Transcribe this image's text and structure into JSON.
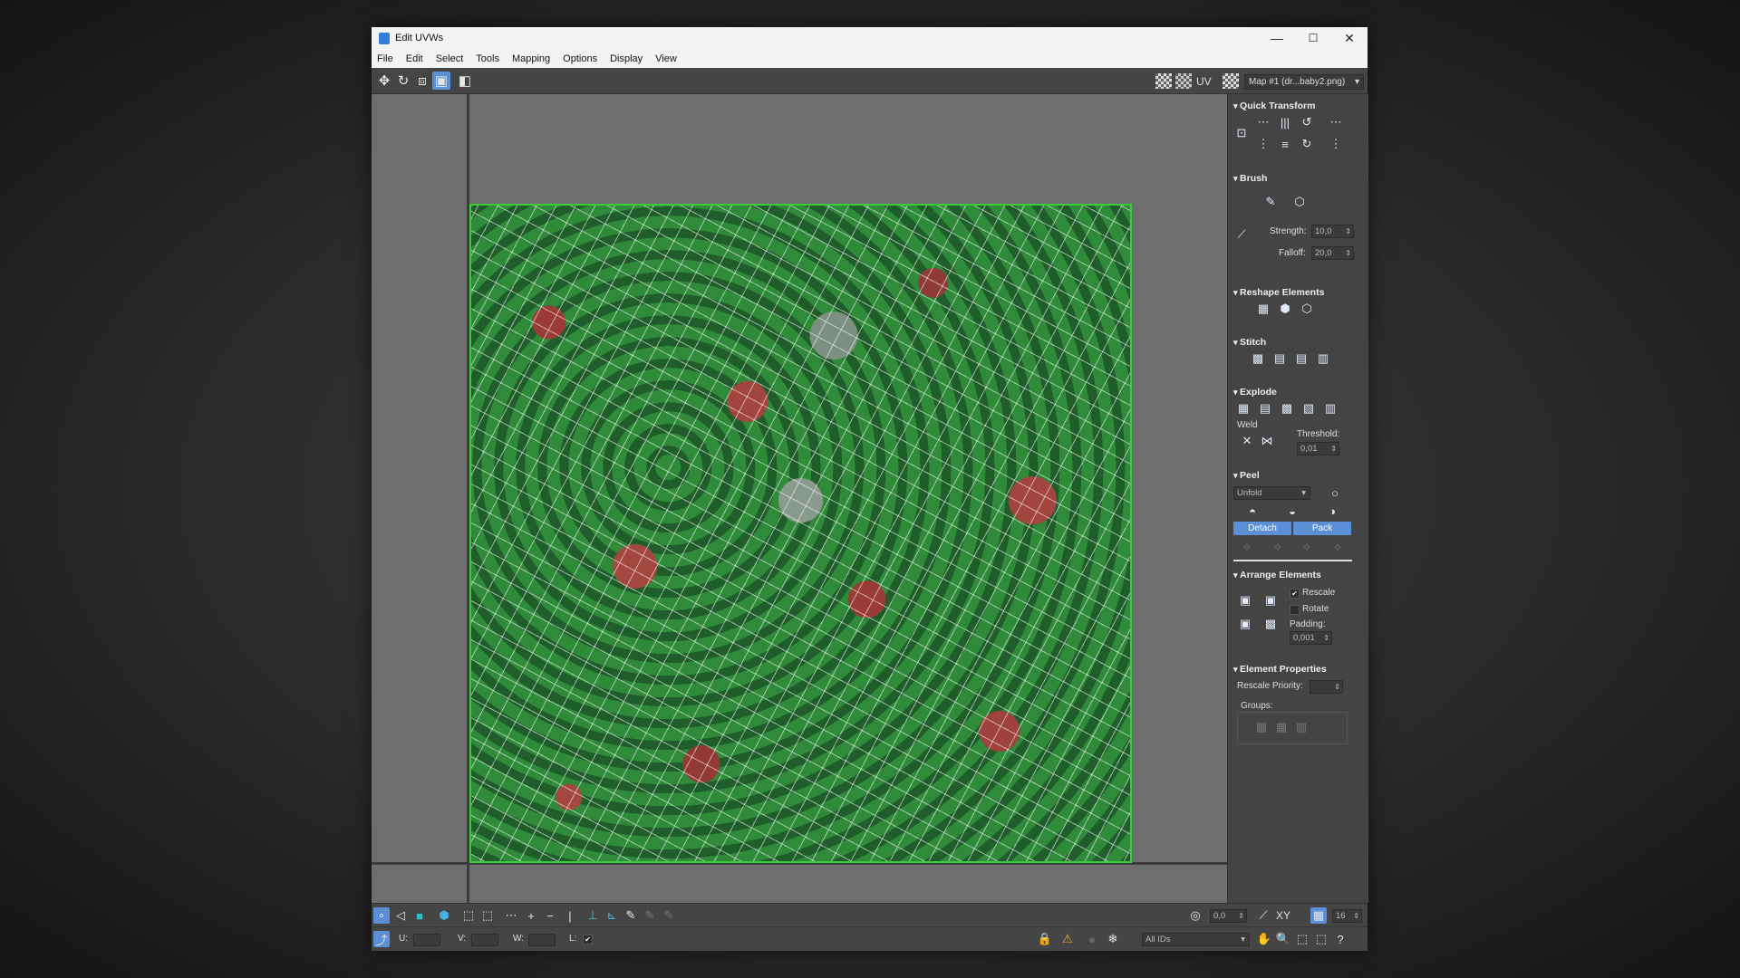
{
  "window": {
    "title": "Edit UVWs",
    "controls": {
      "minimize": "—",
      "maximize": "☐",
      "close": "✕"
    }
  },
  "menu": [
    "File",
    "Edit",
    "Select",
    "Tools",
    "Mapping",
    "Options",
    "Display",
    "View"
  ],
  "toolbar": {
    "uv_label": "UV",
    "map_select": "Map #1 (dr...baby2.png)"
  },
  "panel": {
    "quick_transform": {
      "title": "Quick Transform"
    },
    "brush": {
      "title": "Brush",
      "strength_label": "Strength:",
      "strength_value": "10,0",
      "falloff_label": "Falloff:",
      "falloff_value": "20,0"
    },
    "reshape": {
      "title": "Reshape Elements"
    },
    "stitch": {
      "title": "Stitch"
    },
    "explode": {
      "title": "Explode",
      "weld_label": "Weld",
      "threshold_label": "Threshold:",
      "threshold_value": "0,01"
    },
    "peel": {
      "title": "Peel",
      "mode_value": "Unfold",
      "detach_label": "Detach",
      "pack_label": "Pack"
    },
    "arrange": {
      "title": "Arrange Elements",
      "rescale_label": "Rescale",
      "rescale_checked": "✔",
      "rotate_label": "Rotate",
      "padding_label": "Padding:",
      "padding_value": "0,001"
    },
    "element_props": {
      "title": "Element Properties",
      "rescale_priority_label": "Rescale Priority:",
      "groups_label": "Groups:"
    }
  },
  "bottom": {
    "soft_value": "0,0",
    "xy_label": "XY",
    "grid_value": "16",
    "u_label": "U:",
    "v_label": "V:",
    "w_label": "W:",
    "l_label": "L:",
    "l_checked": "✔",
    "ids_value": "All IDs"
  },
  "colors": {
    "accent": "#5b8fd6",
    "uv_edge": "#3ec83e"
  }
}
